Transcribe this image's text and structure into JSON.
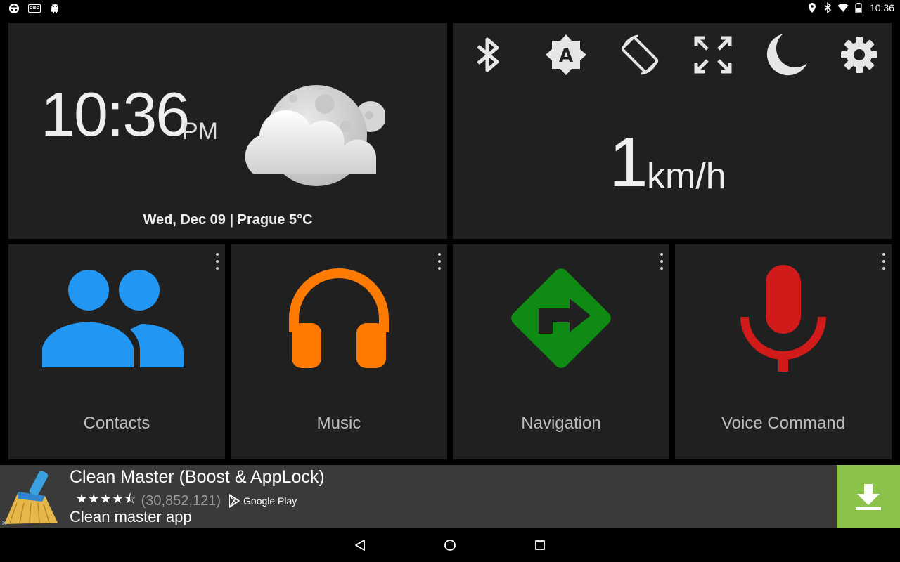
{
  "status_bar": {
    "left_icons": [
      "steering-wheel-icon",
      "obd-icon",
      "android-icon"
    ],
    "obd_label": "OBD",
    "right_icons": [
      "location-icon",
      "bluetooth-icon",
      "wifi-icon",
      "battery-icon"
    ],
    "time": "10:36"
  },
  "clock": {
    "time": "10:36",
    "ampm": "PM",
    "date_location": "Wed, Dec 09 | Prague 5°C",
    "weather_icon": "cloudy-night-icon"
  },
  "quick_settings": [
    {
      "id": "bluetooth",
      "icon": "bluetooth-icon"
    },
    {
      "id": "auto-brightness",
      "icon": "auto-brightness-icon",
      "letter": "A"
    },
    {
      "id": "rotation",
      "icon": "screen-rotation-icon"
    },
    {
      "id": "fullscreen",
      "icon": "fullscreen-icon"
    },
    {
      "id": "night-mode",
      "icon": "moon-icon"
    },
    {
      "id": "settings",
      "icon": "gear-icon"
    }
  ],
  "speed": {
    "value": "1",
    "unit": "km/h"
  },
  "apps": [
    {
      "label": "Contacts",
      "icon": "contacts-icon",
      "color": "#2196f3"
    },
    {
      "label": "Music",
      "icon": "headphones-icon",
      "color": "#ff7a00"
    },
    {
      "label": "Navigation",
      "icon": "navigation-icon",
      "color": "#0f8a12"
    },
    {
      "label": "Voice Command",
      "icon": "microphone-icon",
      "color": "#d11a1a"
    }
  ],
  "ad": {
    "title": "Clean Master (Boost & AppLock)",
    "rating": 4.5,
    "stars": "★★★★⯪",
    "review_count": "(30,852,121)",
    "store": "Google Play",
    "description": "Clean master app",
    "accent_color": "#8bc34a"
  },
  "nav_bar": {
    "buttons": [
      "back",
      "home",
      "recents"
    ]
  }
}
